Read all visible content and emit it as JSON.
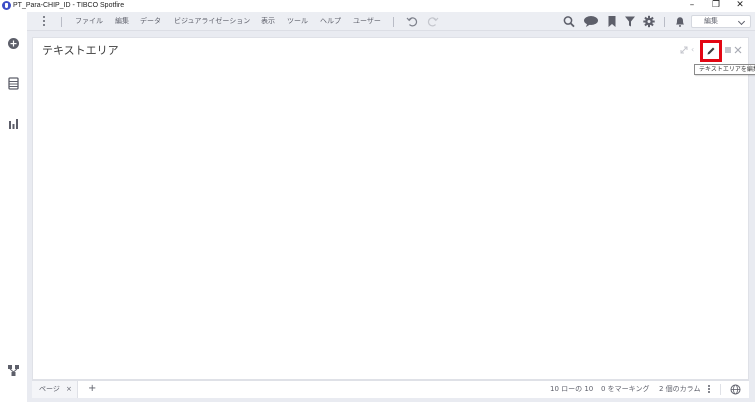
{
  "window": {
    "title": "PT_Para-CHIP_ID - TIBCO Spotfire",
    "minimize": "–",
    "restore": "❐",
    "close": "✕"
  },
  "menu": {
    "items": [
      "ファイル",
      "編集",
      "データ",
      "ビジュアライゼーション",
      "表示",
      "ツール",
      "ヘルプ",
      "ユーザー"
    ],
    "mode_select": "編集"
  },
  "panel": {
    "title": "テキストエリア",
    "tooltip": "テキストエリアを編集"
  },
  "bottom": {
    "page_tab": "ページ",
    "page_tab_close": "×",
    "add_page": "+",
    "rows": "10 ローの 10",
    "marking": "0 をマーキング",
    "columns": "2 個のカラム"
  },
  "colors": {
    "accent": "#3d4ec8",
    "highlight": "#e30613",
    "menubar_bg": "#eceef3",
    "canvas_bg": "#e9ebf1"
  },
  "icons": {
    "left_rail": [
      "add-circle-icon",
      "data-table-icon",
      "bar-chart-icon",
      "data-relations-icon"
    ],
    "toolbar": [
      "undo-icon",
      "redo-icon",
      "search-icon",
      "comment-icon",
      "bookmark-icon",
      "filter-icon",
      "gear-icon",
      "bell-icon"
    ],
    "panel": [
      "maximize-icon",
      "pencil-icon",
      "close-icon"
    ]
  }
}
